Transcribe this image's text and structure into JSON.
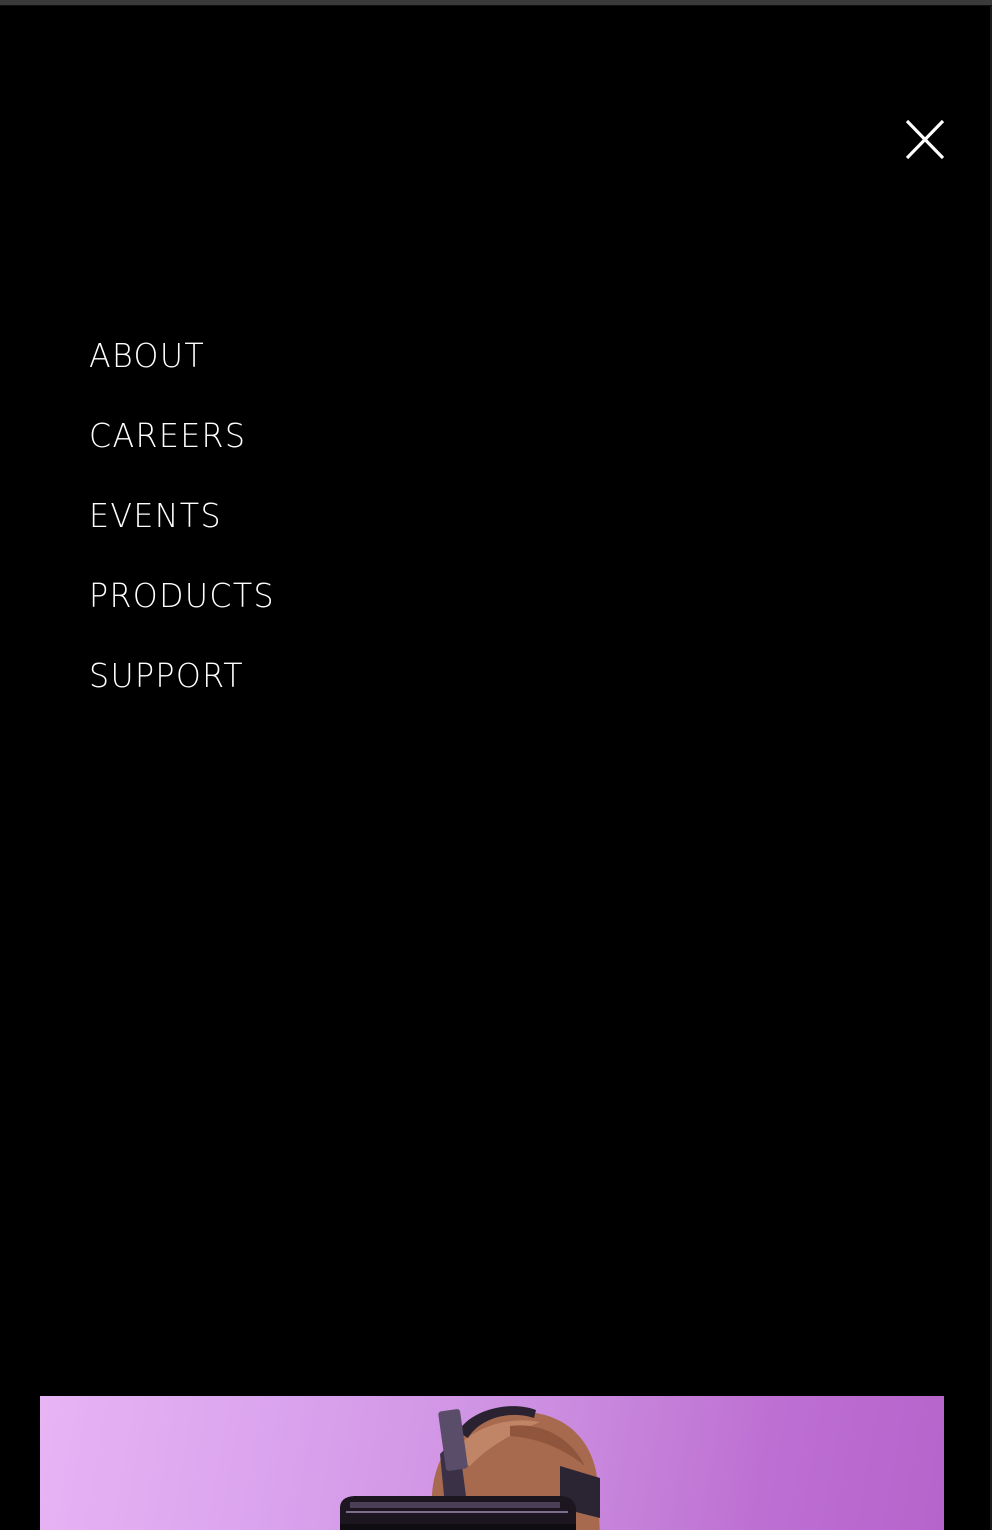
{
  "menu": {
    "close_icon": "close-icon",
    "items": [
      {
        "label": "ABOUT"
      },
      {
        "label": "CAREERS"
      },
      {
        "label": "EVENTS"
      },
      {
        "label": "PRODUCTS"
      },
      {
        "label": "SUPPORT"
      }
    ]
  },
  "hero": {
    "image_subject": "person-wearing-vr-headset"
  },
  "colors": {
    "background": "#000000",
    "text": "#ffffff",
    "hero_gradient_start": "#e8b4f4",
    "hero_gradient_end": "#b664cb"
  }
}
